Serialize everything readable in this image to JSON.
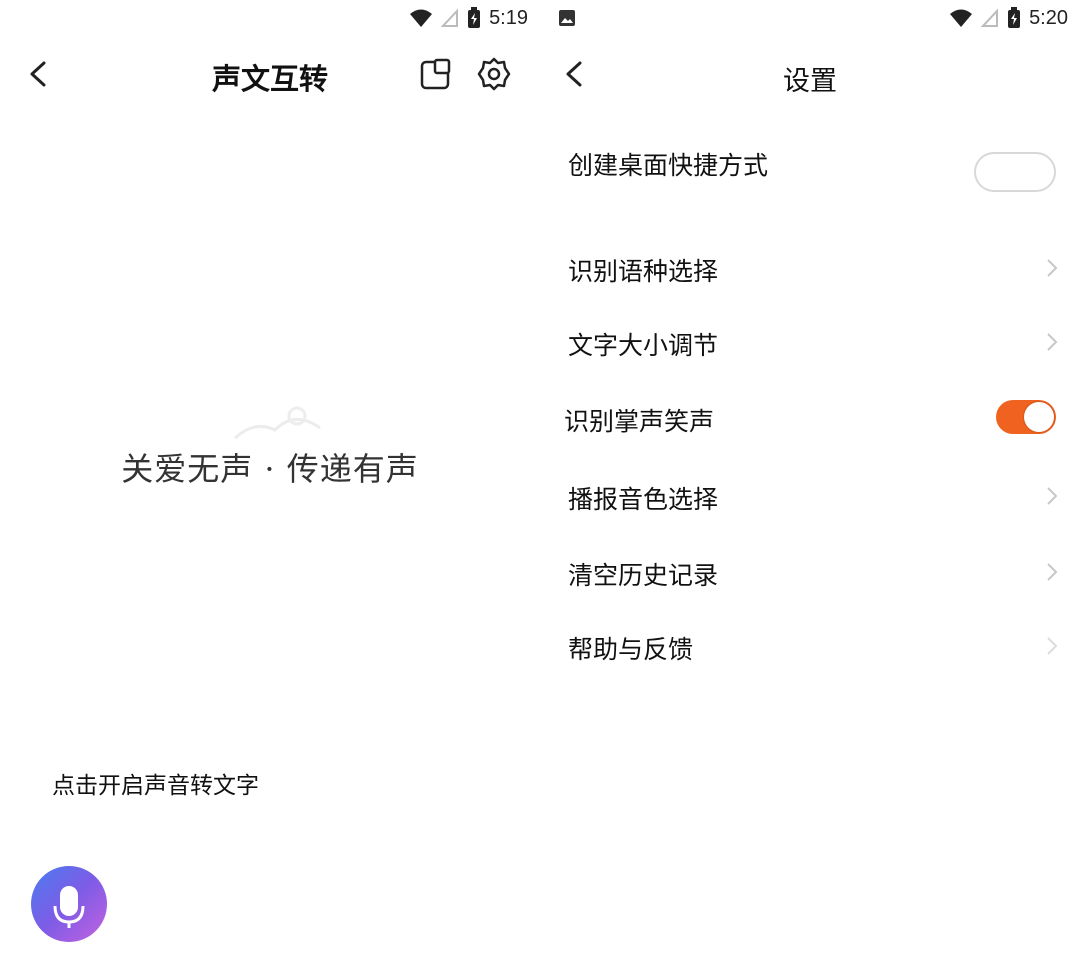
{
  "left_screen": {
    "status_bar": {
      "time": "5:19"
    },
    "header": {
      "title": "声文互转"
    },
    "slogan": "关爱无声 · 传递有声",
    "slogan_sub": "",
    "prompt": "点击开启声音转文字",
    "mic_hint": ""
  },
  "right_screen": {
    "status_bar": {
      "time": "5:20"
    },
    "header": {
      "title": "设置"
    },
    "settings": {
      "shortcut": {
        "label": "创建桌面快捷方式",
        "sub": "",
        "button": ""
      },
      "language": {
        "label": "识别语种选择",
        "value": ""
      },
      "text_size": {
        "label": "文字大小调节",
        "value": ""
      },
      "applause": {
        "label": "识别掌声笑声",
        "enabled": true
      },
      "voice": {
        "label": "播报音色选择",
        "value": ""
      },
      "clear_history": {
        "label": "清空历史记录"
      },
      "help": {
        "label": "帮助与反馈"
      }
    }
  },
  "colors": {
    "toggle_on": "#f0621f",
    "mic_gradient_start": "#4a7cf0",
    "mic_gradient_end": "#c462e0"
  },
  "icons": [
    "wifi-icon",
    "signal-icon",
    "battery-icon",
    "gallery-notification-icon",
    "back-arrow-icon",
    "floating-window-icon",
    "gear-icon",
    "microphone-icon",
    "chevron-right-icon"
  ]
}
